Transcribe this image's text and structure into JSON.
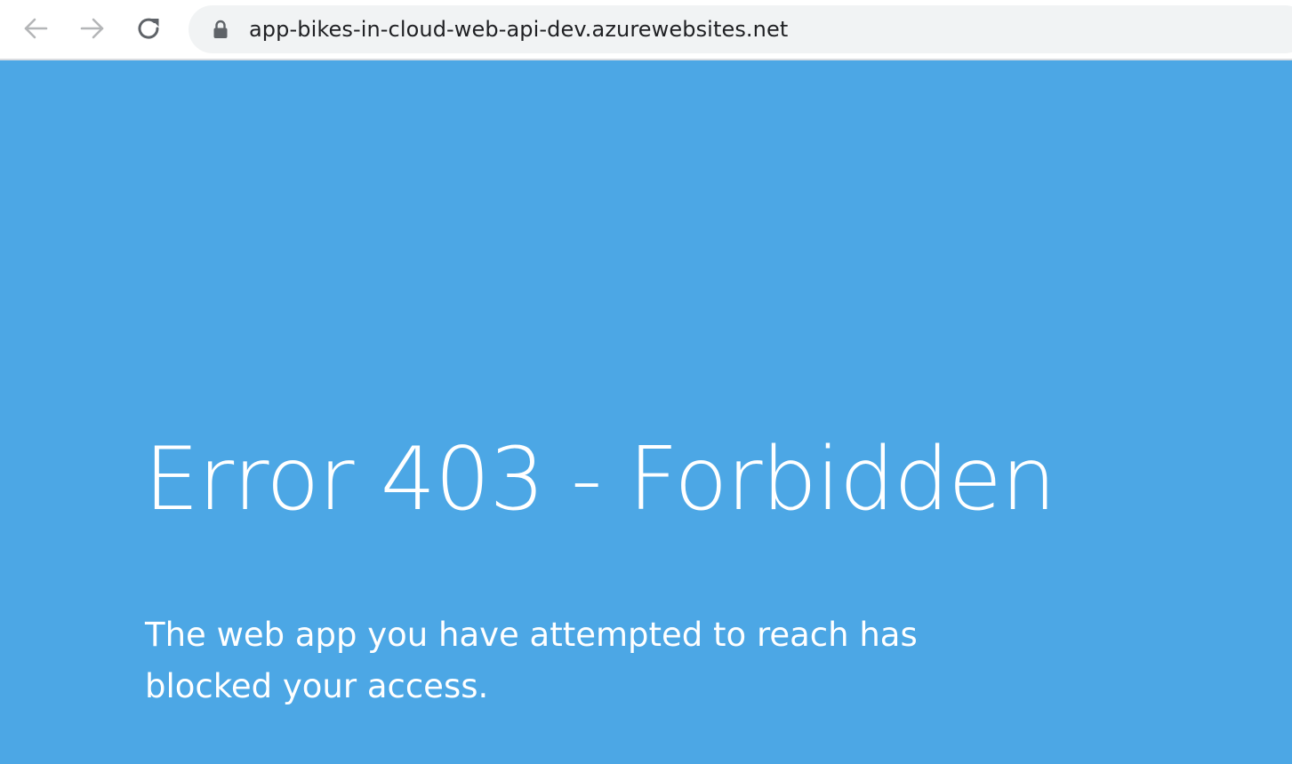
{
  "browser": {
    "url": "app-bikes-in-cloud-web-api-dev.azurewebsites.net",
    "icons": {
      "back": "arrow-left-icon",
      "forward": "arrow-right-icon",
      "reload": "reload-icon",
      "lock": "lock-icon"
    }
  },
  "page": {
    "title": "Error 403 - Forbidden",
    "message": "The web app you have attempted to reach has blocked your access.",
    "background_color": "#4ca7e5",
    "text_color": "#ffffff"
  }
}
